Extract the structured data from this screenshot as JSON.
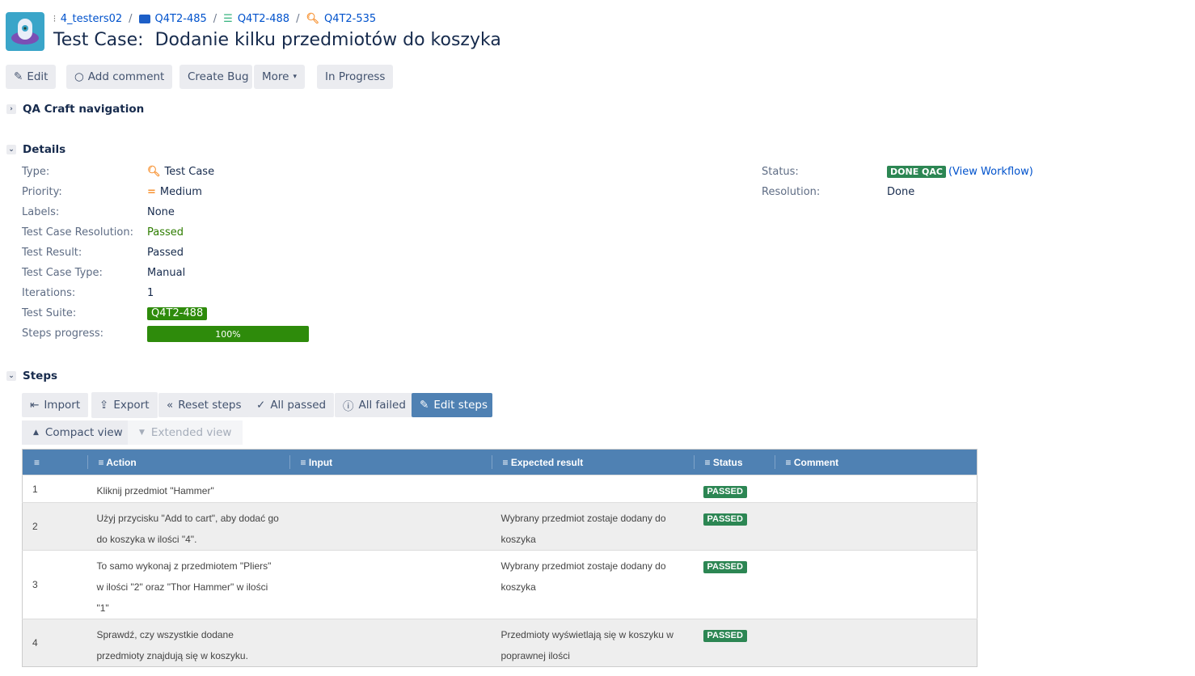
{
  "breadcrumbs": [
    "4_testers02",
    "Q4T2-485",
    "Q4T2-488",
    "Q4T2-535"
  ],
  "title": {
    "type": "Test Case:",
    "name": "Dodanie kilku przedmiotów do koszyka"
  },
  "toolbar": {
    "edit": "Edit",
    "comment": "Add comment",
    "create_bug": "Create Bug",
    "more": "More",
    "in_progress": "In Progress"
  },
  "sections": {
    "nav": "QA Craft navigation",
    "details": "Details",
    "steps": "Steps"
  },
  "details": {
    "type_label": "Type:",
    "type": "Test Case",
    "priority_label": "Priority:",
    "priority": "Medium",
    "labels_label": "Labels:",
    "labels": "None",
    "tcr_label": "Test Case Resolution:",
    "tcr": "Passed",
    "result_label": "Test Result:",
    "result": "Passed",
    "tct_label": "Test Case Type:",
    "tct": "Manual",
    "iter_label": "Iterations:",
    "iter": "1",
    "suite_label": "Test Suite:",
    "suite": "Q4T2-488",
    "progress_label": "Steps progress:",
    "progress": "100%",
    "progress_value": 100,
    "status_label": "Status:",
    "status": "DONE QAC",
    "workflow": "(View Workflow)",
    "resolution_label": "Resolution:",
    "resolution": "Done"
  },
  "steps_toolbar": {
    "import": "Import",
    "export": "Export",
    "reset": "Reset steps",
    "all_passed": "All passed",
    "all_failed": "All failed",
    "edit": "Edit steps",
    "compact": "Compact view",
    "extended": "Extended view"
  },
  "table": {
    "headers": [
      "Action",
      "Input",
      "Expected result",
      "Status",
      "Comment"
    ],
    "rows": [
      {
        "n": "1",
        "action": "Kliknij przedmiot \"Hammer\"",
        "input": "",
        "expected": "",
        "status": "PASSED",
        "comment": ""
      },
      {
        "n": "2",
        "action": "Użyj przycisku \"Add to cart\", aby dodać go do koszyka w ilości \"4\".",
        "input": "",
        "expected": "Wybrany przedmiot zostaje dodany do koszyka",
        "status": "PASSED",
        "comment": ""
      },
      {
        "n": "3",
        "action": "To samo wykonaj z przedmiotem \"Pliers\" w ilości \"2\" oraz \"Thor Hammer\" w ilości \"1\"",
        "input": "",
        "expected": "Wybrany przedmiot zostaje dodany do koszyka",
        "status": "PASSED",
        "comment": ""
      },
      {
        "n": "4",
        "action": "Sprawdź, czy wszystkie dodane przedmioty znajdują się w koszyku.",
        "input": "",
        "expected": "Przedmioty wyświetlają się w koszyku w poprawnej ilości",
        "status": "PASSED",
        "comment": ""
      }
    ]
  }
}
